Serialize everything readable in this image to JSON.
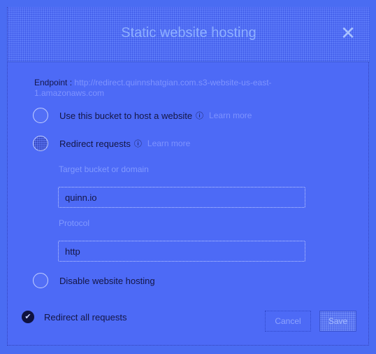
{
  "dialog": {
    "title": "Static website hosting",
    "close_glyph": "✕"
  },
  "endpoint": {
    "label": "Endpoint :",
    "value": "http://redirect.quinnshatgian.com.s3-website-us-east-1.amazonaws.com"
  },
  "options": {
    "host": {
      "label": "Use this bucket to host a website",
      "info": "ⓘ",
      "learn": "Learn more",
      "selected": false
    },
    "redirect": {
      "label": "Redirect requests",
      "info": "ⓘ",
      "learn": "Learn more",
      "selected": true
    },
    "disable": {
      "label": "Disable website hosting",
      "selected": false
    }
  },
  "redirect_form": {
    "target_label": "Target bucket or domain",
    "target_value": "quinn.io",
    "protocol_label": "Protocol",
    "protocol_value": "http"
  },
  "footer": {
    "status_label": "Redirect all requests",
    "check_glyph": "✔",
    "cancel_label": "Cancel",
    "save_label": "Save"
  }
}
